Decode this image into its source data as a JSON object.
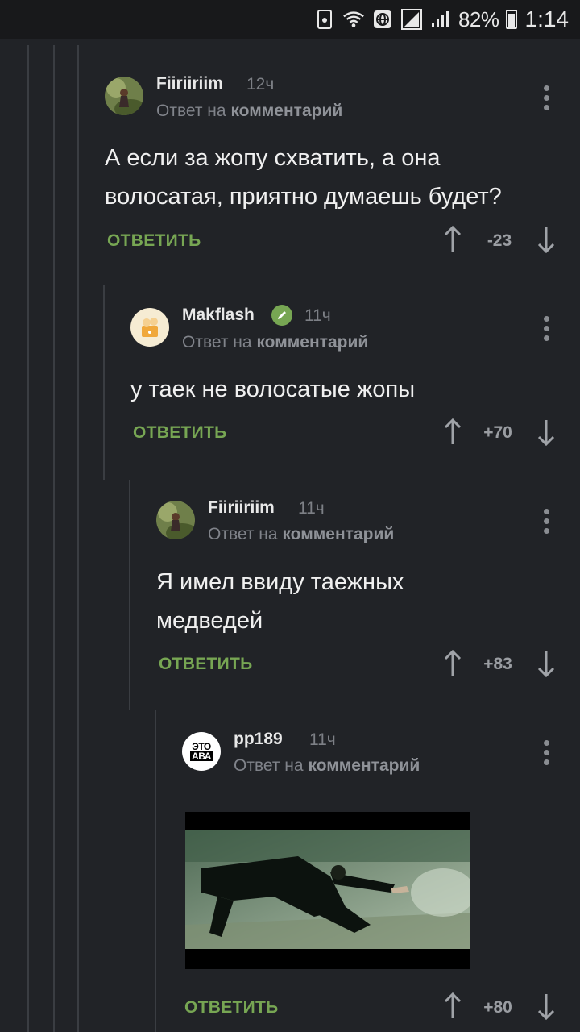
{
  "status_bar": {
    "battery": "82%",
    "time": "1:14"
  },
  "colors": {
    "background": "#212327",
    "accent_green": "#77a653",
    "thread_line": "#3a3d42",
    "meta_gray": "#80838a"
  },
  "icons": {
    "upvote": "arrow-up-icon",
    "downvote": "arrow-down-icon",
    "menu": "more-vert-icon",
    "edit": "pencil-icon"
  },
  "comments": [
    {
      "username": "Fiiriiriim",
      "time": "12ч",
      "reply_prefix": "Ответ на",
      "reply_target": "комментарий",
      "text_line1": "А если за жопу схватить, а она",
      "text_line2": "волосатая, приятно думаешь будет?",
      "reply_label": "ОТВЕТИТЬ",
      "score": "-23"
    },
    {
      "username": "Makflash",
      "time": "11ч",
      "reply_prefix": "Ответ на",
      "reply_target": "комментарий",
      "text_line1": "у таек не волосатые жопы",
      "reply_label": "ОТВЕТИТЬ",
      "score": "+70"
    },
    {
      "username": "Fiiriiriim",
      "time": "11ч",
      "reply_prefix": "Ответ на",
      "reply_target": "комментарий",
      "text_line1": "Я имел ввиду таежных",
      "text_line2": "медведей",
      "reply_label": "ОТВЕТИТЬ",
      "score": "+83"
    },
    {
      "username": "pp189",
      "time": "11ч",
      "reply_prefix": "Ответ на",
      "reply_target": "комментарий",
      "avatar_text1": "ЭТО",
      "avatar_text2": "АВА",
      "reply_label": "ОТВЕТИТЬ",
      "score": "+80"
    }
  ]
}
